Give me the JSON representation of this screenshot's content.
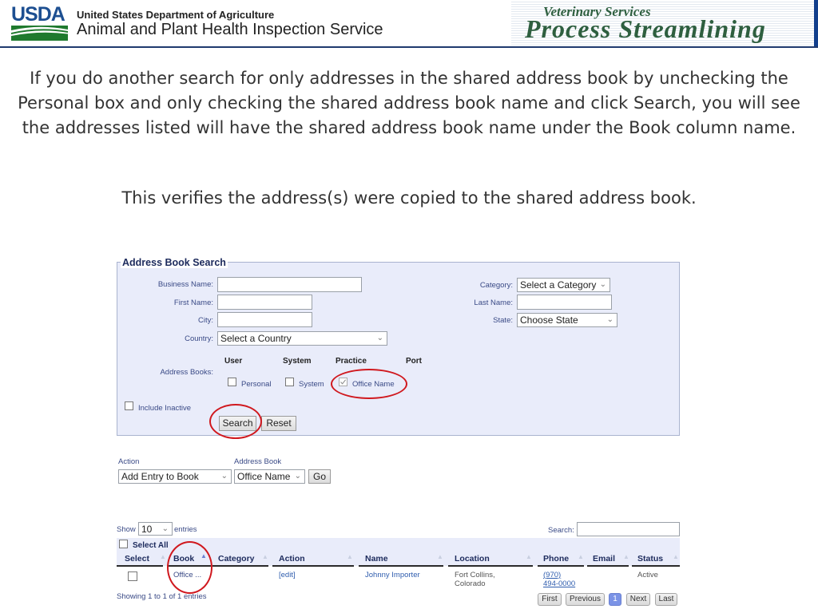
{
  "header": {
    "logo_text": "USDA",
    "department": "United States Department of Agriculture",
    "agency": "Animal and Plant Health Inspection Service",
    "banner_small": "Veterinary Services",
    "banner_big": "Process Streamlining"
  },
  "instructions": {
    "paragraph": "If you do another search for only addresses in the shared address book by unchecking the Personal box and only checking the shared address book name and click Search, you will see the addresses listed will have the shared address book name under the Book column name.",
    "verify": "This verifies the address(s) were copied to the shared address book."
  },
  "search_panel": {
    "title": "Address Book Search",
    "business_name_label": "Business Name:",
    "business_name_value": "",
    "first_name_label": "First Name:",
    "first_name_value": "",
    "city_label": "City:",
    "city_value": "",
    "country_label": "Country:",
    "country_value": "Select a Country",
    "category_label": "Category:",
    "category_value": "Select a Category",
    "last_name_label": "Last Name:",
    "last_name_value": "",
    "state_label": "State:",
    "state_value": "Choose State",
    "address_books_label": "Address Books:",
    "book_columns": [
      "User",
      "System",
      "Practice",
      "Port"
    ],
    "books": [
      {
        "label": "Personal",
        "checked": false
      },
      {
        "label": "System",
        "checked": false
      },
      {
        "label": "Office Name",
        "checked": true
      }
    ],
    "include_inactive_label": "Include Inactive",
    "include_inactive_checked": false,
    "search_button": "Search",
    "reset_button": "Reset"
  },
  "action_bar": {
    "action_label": "Action",
    "action_value": "Add Entry to Book",
    "address_book_label": "Address Book",
    "address_book_value": "Office Name",
    "go_button": "Go"
  },
  "results": {
    "show_label": "Show",
    "page_size": "10",
    "entries_label": "entries",
    "search_label": "Search:",
    "search_value": "",
    "select_all_label": "Select All",
    "columns": [
      "Select",
      "Book",
      "Category",
      "Action",
      "Name",
      "Location",
      "Phone",
      "Email",
      "Status"
    ],
    "sorted_column": "Book",
    "rows": [
      {
        "book": "Office ...",
        "category": "",
        "action": "[edit]",
        "name": "Johnny Importer",
        "location_line1": "Fort Collins,",
        "location_line2": "Colorado",
        "phone_line1": "(970)",
        "phone_line2": "494-0000",
        "email": "",
        "status": "Active"
      }
    ],
    "summary": "Showing 1 to 1 of 1 entries",
    "pagination": {
      "first": "First",
      "previous": "Previous",
      "current_page": "1",
      "next": "Next",
      "last": "Last"
    }
  },
  "colors": {
    "annotation_red": "#d0181e",
    "panel_bg": "#e9ecfa",
    "label_blue": "#3a4a86",
    "link_blue": "#2f5dae",
    "active_page": "#7b93e6"
  }
}
